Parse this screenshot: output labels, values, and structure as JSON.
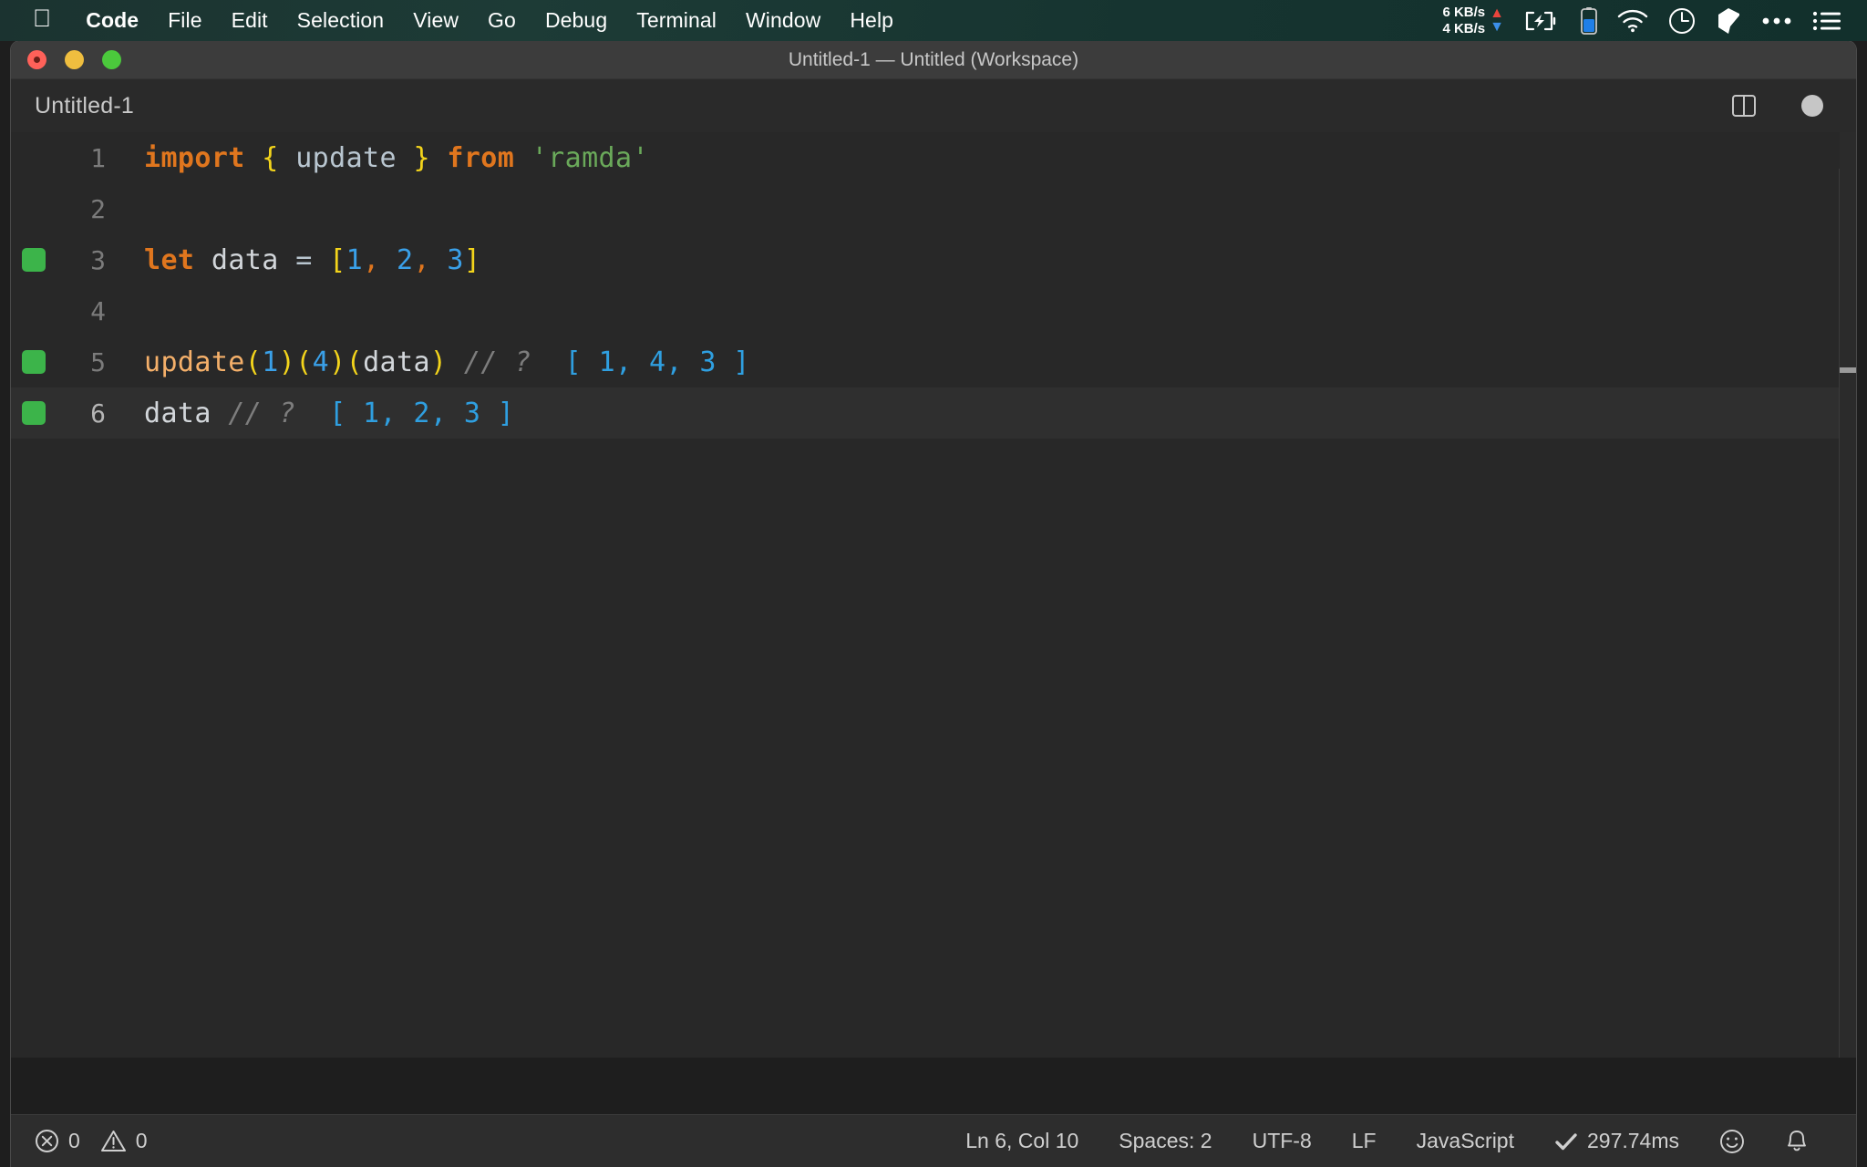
{
  "menubar": {
    "apple_icon": "apple-logo-icon",
    "items": [
      {
        "label": "Code",
        "bold": true
      },
      {
        "label": "File",
        "bold": false
      },
      {
        "label": "Edit",
        "bold": false
      },
      {
        "label": "Selection",
        "bold": false
      },
      {
        "label": "View",
        "bold": false
      },
      {
        "label": "Go",
        "bold": false
      },
      {
        "label": "Debug",
        "bold": false
      },
      {
        "label": "Terminal",
        "bold": false
      },
      {
        "label": "Window",
        "bold": false
      },
      {
        "label": "Help",
        "bold": false
      }
    ],
    "status": {
      "net_up": "6 KB/s",
      "net_down": "4 KB/s",
      "up_arrow": "▲",
      "down_arrow": "▼",
      "up_color": "#e8453c",
      "down_color": "#3b8fe8",
      "battery_icon": "battery-charging-icon",
      "battery_level_icon": "battery-level-icon",
      "battery_level_color": "#1f7fe8",
      "wifi_icon": "wifi-icon",
      "clock_icon": "clock-icon",
      "cube_icon": "cube-icon",
      "ellipsis_icon": "ellipsis-icon",
      "list_icon": "list-menu-icon"
    }
  },
  "window": {
    "title": "Untitled-1 — Untitled (Workspace)",
    "traffic_lights": [
      "close-button",
      "minimize-button",
      "zoom-button"
    ]
  },
  "editor": {
    "tab_title": "Untitled-1",
    "split_icon": "split-editor-icon",
    "dirty_indicator": "unsaved-dot-icon",
    "lines": [
      {
        "number": "1",
        "marked": false,
        "current": false,
        "tokens": [
          {
            "t": "import",
            "c": "kw"
          },
          {
            "t": " ",
            "c": "plain"
          },
          {
            "t": "{",
            "c": "brace"
          },
          {
            "t": " ",
            "c": "plain"
          },
          {
            "t": "update",
            "c": "ident"
          },
          {
            "t": " ",
            "c": "plain"
          },
          {
            "t": "}",
            "c": "brace"
          },
          {
            "t": " ",
            "c": "plain"
          },
          {
            "t": "from",
            "c": "kw"
          },
          {
            "t": " ",
            "c": "plain"
          },
          {
            "t": "'ramda'",
            "c": "str"
          }
        ]
      },
      {
        "number": "2",
        "marked": false,
        "current": false,
        "tokens": []
      },
      {
        "number": "3",
        "marked": true,
        "current": false,
        "tokens": [
          {
            "t": "let",
            "c": "kw"
          },
          {
            "t": " ",
            "c": "plain"
          },
          {
            "t": "data",
            "c": "plain"
          },
          {
            "t": " ",
            "c": "plain"
          },
          {
            "t": "=",
            "c": "op"
          },
          {
            "t": " ",
            "c": "plain"
          },
          {
            "t": "[",
            "c": "brace"
          },
          {
            "t": "1",
            "c": "num"
          },
          {
            "t": ",",
            "c": "punct"
          },
          {
            "t": " ",
            "c": "plain"
          },
          {
            "t": "2",
            "c": "num"
          },
          {
            "t": ",",
            "c": "punct"
          },
          {
            "t": " ",
            "c": "plain"
          },
          {
            "t": "3",
            "c": "num"
          },
          {
            "t": "]",
            "c": "brace"
          }
        ]
      },
      {
        "number": "4",
        "marked": false,
        "current": false,
        "tokens": []
      },
      {
        "number": "5",
        "marked": true,
        "current": false,
        "tokens": [
          {
            "t": "update",
            "c": "fn"
          },
          {
            "t": "(",
            "c": "paren"
          },
          {
            "t": "1",
            "c": "num"
          },
          {
            "t": ")",
            "c": "paren"
          },
          {
            "t": "(",
            "c": "paren"
          },
          {
            "t": "4",
            "c": "num"
          },
          {
            "t": ")",
            "c": "paren"
          },
          {
            "t": "(",
            "c": "paren"
          },
          {
            "t": "data",
            "c": "plain"
          },
          {
            "t": ")",
            "c": "paren"
          },
          {
            "t": " ",
            "c": "plain"
          },
          {
            "t": "// ?",
            "c": "comment"
          },
          {
            "t": "  ",
            "c": "plain"
          },
          {
            "t": "[ 1, 4, 3 ]",
            "c": "result"
          }
        ]
      },
      {
        "number": "6",
        "marked": true,
        "current": true,
        "tokens": [
          {
            "t": "data",
            "c": "plain"
          },
          {
            "t": " ",
            "c": "plain"
          },
          {
            "t": "// ?",
            "c": "comment"
          },
          {
            "t": "  ",
            "c": "plain"
          },
          {
            "t": "[ 1, 2, 3 ]",
            "c": "result"
          }
        ]
      }
    ],
    "gutter_marker_color": "#3cb44a"
  },
  "statusbar": {
    "errors_icon": "error-circle-icon",
    "errors_count": "0",
    "warnings_icon": "warning-triangle-icon",
    "warnings_count": "0",
    "cursor_position": "Ln 6, Col 10",
    "indentation": "Spaces: 2",
    "encoding": "UTF-8",
    "eol": "LF",
    "language": "JavaScript",
    "run_check_icon": "check-mark-icon",
    "run_time": "297.74ms",
    "feedback_icon": "smiley-icon",
    "notifications_icon": "bell-icon"
  }
}
